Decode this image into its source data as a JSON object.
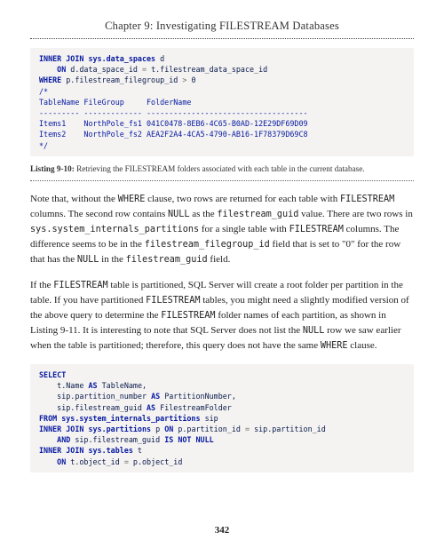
{
  "header": {
    "chapter_title": "Chapter 9: Investigating FILESTREAM Databases"
  },
  "code1": {
    "line1a": "INNER JOIN",
    "line1b": " sys.data_spaces",
    "line1c": " d",
    "line2a": "    ON",
    "line2b": " d.data_space_id ",
    "line2c": "=",
    "line2d": " t.filestream_data_space_id",
    "line3a": "WHERE",
    "line3b": " p.filestream_filegroup_id ",
    "line3c": ">",
    "line3d": " 0",
    "line4": "/*",
    "line5": "TableName FileGroup     FolderName",
    "line6": "--------- ------------- ------------------------------------",
    "line7": "Items1    NorthPole_fs1 041C0478-8EB6-4C65-B0AD-12E29DF69D09",
    "line8": "Items2    NorthPole_fs2 AEA2F2A4-4CA5-4790-AB16-1F78379D69C8",
    "line9": "*/"
  },
  "listing1": {
    "label": "Listing 9-10:",
    "text": " Retrieving the FILESTREAM folders associated with each table in the current database."
  },
  "para1": {
    "t1": "Note that, without the ",
    "m1": "WHERE",
    "t2": " clause, two rows are returned for each table with ",
    "m2": "FILESTREAM",
    "t3": " columns. The second row contains ",
    "m3": "NULL",
    "t4": " as the ",
    "m4": "filestream_guid",
    "t5": " value. There are two rows in ",
    "m5": "sys.system_internals_partitions",
    "t6": " for a single table with ",
    "m6": "FILESTREAM",
    "t7": " columns. The difference seems to be in the ",
    "m7": "filestream_filegroup_id",
    "t8": " field that is set to \"0\" for the row that has the ",
    "m8": "NULL",
    "t9": " in the ",
    "m9": "filestream_guid",
    "t10": " field."
  },
  "para2": {
    "t1": "If the ",
    "m1": "FILESTREAM",
    "t2": " table is partitioned, SQL Server will create a root folder per partition in the table. If you have partitioned ",
    "m2": "FILESTREAM",
    "t3": " tables, you might need a slightly modified version of the above query to determine the ",
    "m3": "FILESTREAM",
    "t4": " folder names of each partition, as shown in Listing 9-11. It is interesting to note that SQL Server does not list the ",
    "m4": "NULL",
    "t5": " row we saw earlier when the table is partitioned; therefore, this query does not have the same ",
    "m5": "WHERE",
    "t6": " clause."
  },
  "code2": {
    "l1": "SELECT",
    "l2a": "    t.Name ",
    "l2b": "AS",
    "l2c": " TableName,",
    "l3a": "    sip.partition_number ",
    "l3b": "AS",
    "l3c": " PartitionNumber,",
    "l4a": "    sip.filestream_guid ",
    "l4b": "AS",
    "l4c": " FilestreamFolder",
    "l5a": "FROM",
    "l5b": " sys.system_internals_partitions",
    "l5c": " sip",
    "l6a": "INNER JOIN",
    "l6b": " sys.partitions",
    "l6c": " p ",
    "l6d": "ON",
    "l6e": " p.partition_id ",
    "l6f": "=",
    "l6g": " sip.partition_id",
    "l7a": "    AND",
    "l7b": " sip.filestream_guid ",
    "l7c": "IS NOT NULL",
    "l8a": "INNER JOIN",
    "l8b": " sys.tables",
    "l8c": " t",
    "l9a": "    ON",
    "l9b": " t.object_id ",
    "l9c": "=",
    "l9d": " p.object_id"
  },
  "page_number": "342"
}
